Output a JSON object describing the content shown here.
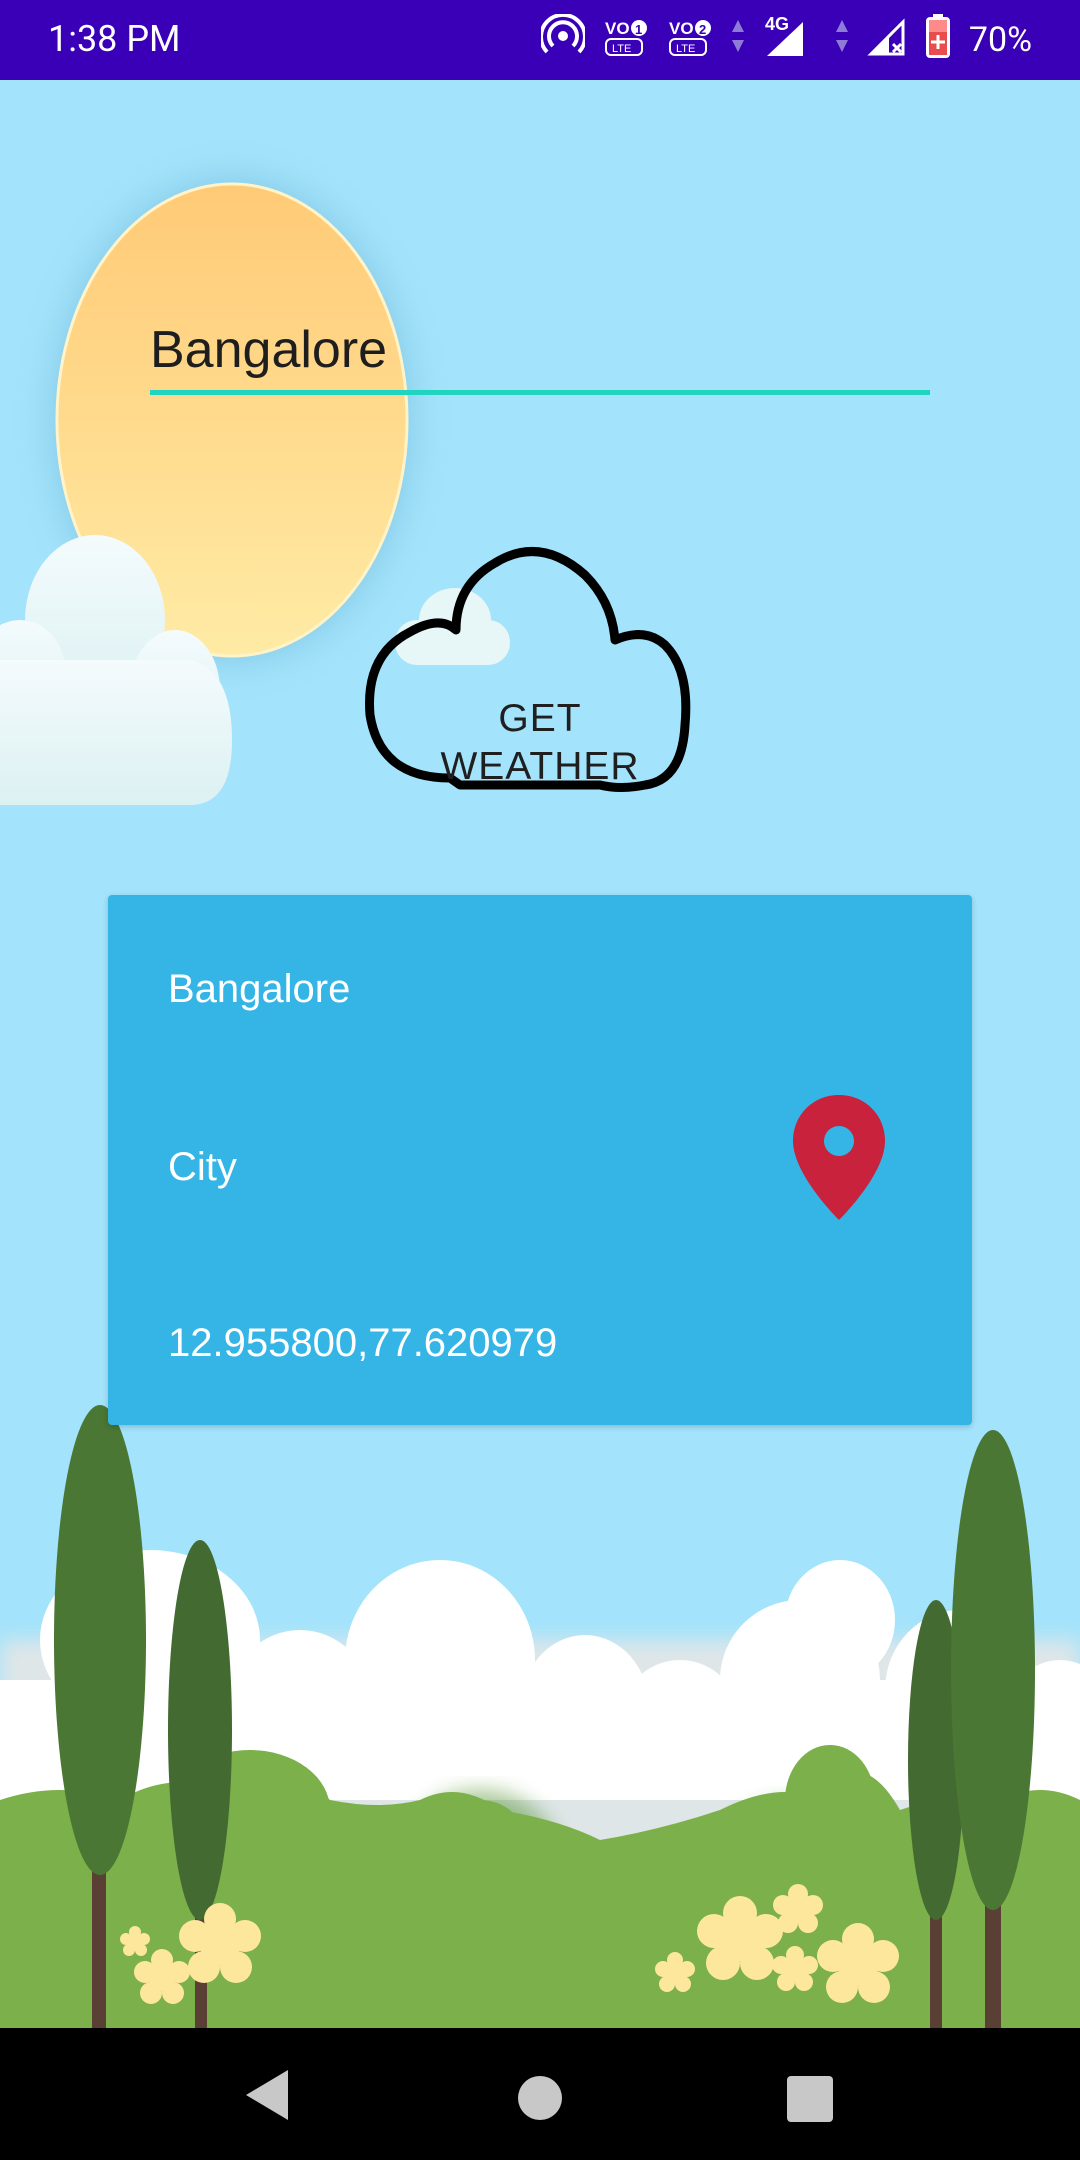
{
  "status_bar": {
    "time": "1:38 PM",
    "battery_percent": "70%",
    "network_type": "4G",
    "sim1_label": "VO LTE",
    "sim2_label": "VO LTE"
  },
  "search": {
    "value": "Bangalore",
    "underline_color": "#21d4bf"
  },
  "get_weather_button": {
    "label": "GET WEATHER"
  },
  "location_card": {
    "name": "Bangalore",
    "type": "City",
    "coordinates": "12.955800,77.620979",
    "background_color": "#35b5e6",
    "pin_color": "#c9223c"
  },
  "nav_bar": {
    "back_icon": "back-triangle-icon",
    "home_icon": "home-circle-icon",
    "recents_icon": "recents-square-icon"
  }
}
